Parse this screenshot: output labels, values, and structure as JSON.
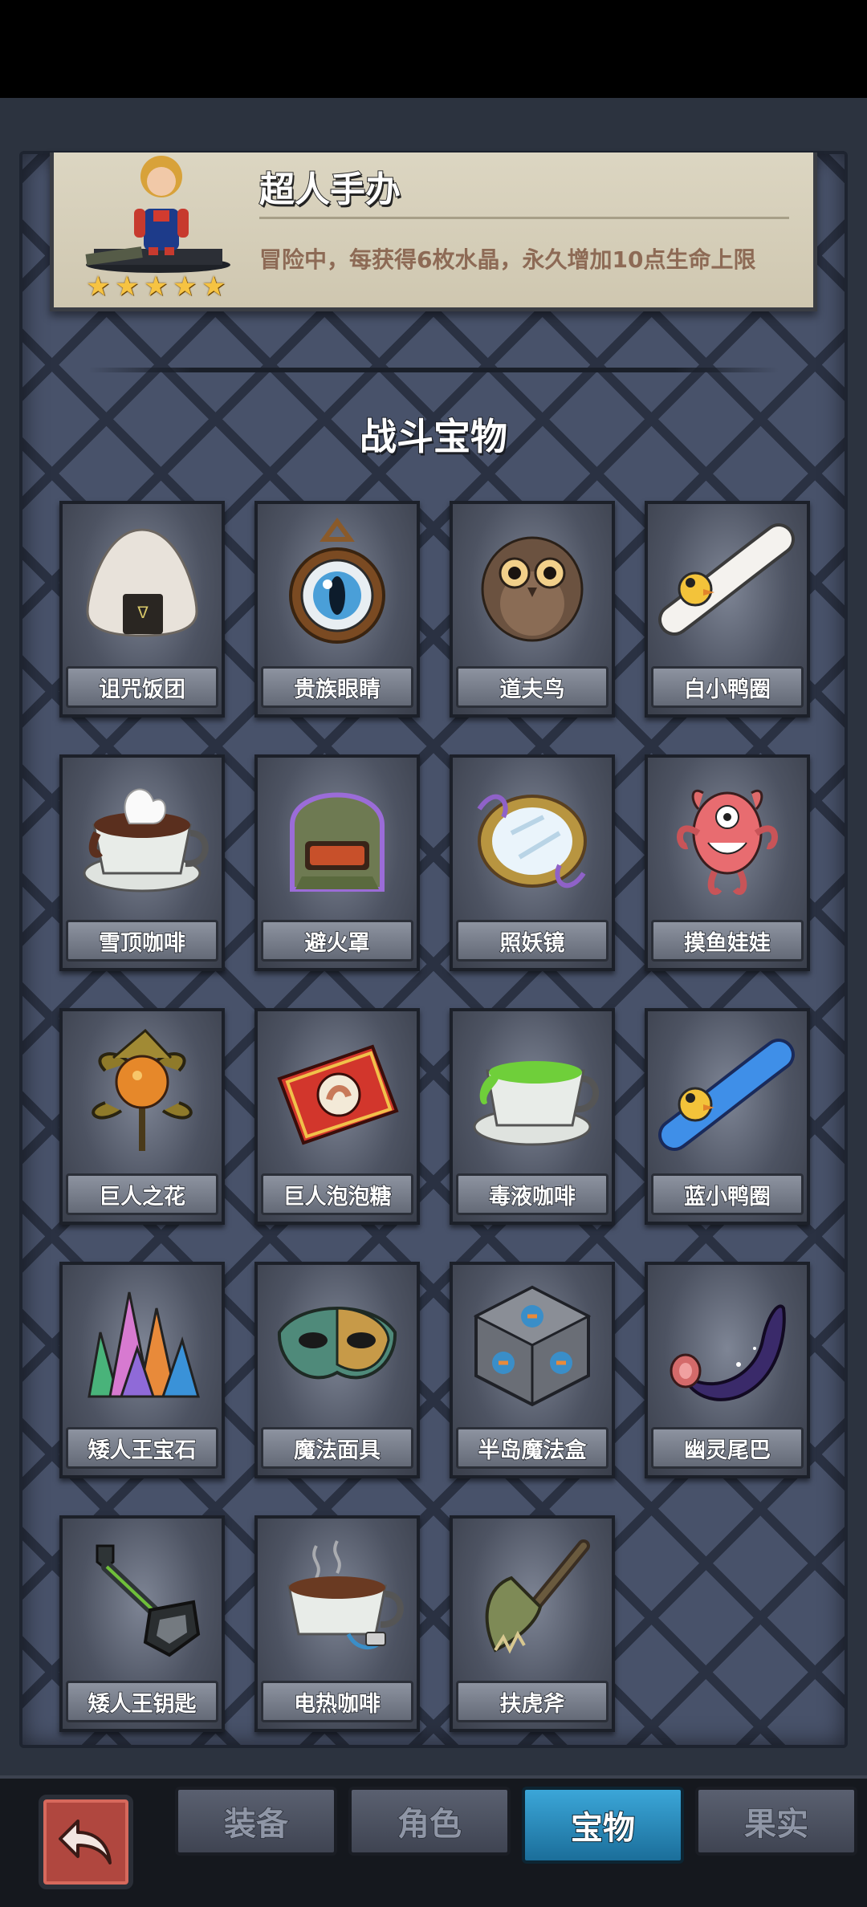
{
  "featured": {
    "title": "超人手办",
    "description": "冒险中，每获得6枚水晶，永久增加10点生命上限",
    "stars": 5
  },
  "section_title": "战斗宝物",
  "items": [
    {
      "label": "诅咒饭团",
      "icon": "rice-ball-icon"
    },
    {
      "label": "贵族眼睛",
      "icon": "eye-pendant-icon"
    },
    {
      "label": "道夫鸟",
      "icon": "owl-icon"
    },
    {
      "label": "白小鸭圈",
      "icon": "white-duck-ring-icon"
    },
    {
      "label": "雪顶咖啡",
      "icon": "snow-coffee-icon"
    },
    {
      "label": "避火罩",
      "icon": "fire-mask-icon"
    },
    {
      "label": "照妖镜",
      "icon": "magic-mirror-icon"
    },
    {
      "label": "摸鱼娃娃",
      "icon": "fish-doll-icon"
    },
    {
      "label": "巨人之花",
      "icon": "giant-flower-icon"
    },
    {
      "label": "巨人泡泡糖",
      "icon": "bubblegum-box-icon"
    },
    {
      "label": "毒液咖啡",
      "icon": "venom-coffee-icon"
    },
    {
      "label": "蓝小鸭圈",
      "icon": "blue-duck-ring-icon"
    },
    {
      "label": "矮人王宝石",
      "icon": "crystal-cluster-icon"
    },
    {
      "label": "魔法面具",
      "icon": "magic-mask-icon"
    },
    {
      "label": "半岛魔法盒",
      "icon": "magic-cube-icon"
    },
    {
      "label": "幽灵尾巴",
      "icon": "ghost-tail-icon"
    },
    {
      "label": "矮人王钥匙",
      "icon": "dwarf-key-icon"
    },
    {
      "label": "电热咖啡",
      "icon": "electric-coffee-icon"
    },
    {
      "label": "扶虎斧",
      "icon": "axe-icon"
    }
  ],
  "tabs": [
    {
      "label": "装备",
      "active": false
    },
    {
      "label": "角色",
      "active": false
    },
    {
      "label": "宝物",
      "active": true
    },
    {
      "label": "果实",
      "active": false
    }
  ],
  "colors": {
    "active_tab": "#2a8fc2",
    "back_button": "#b0473f",
    "star": "#f6c342"
  }
}
